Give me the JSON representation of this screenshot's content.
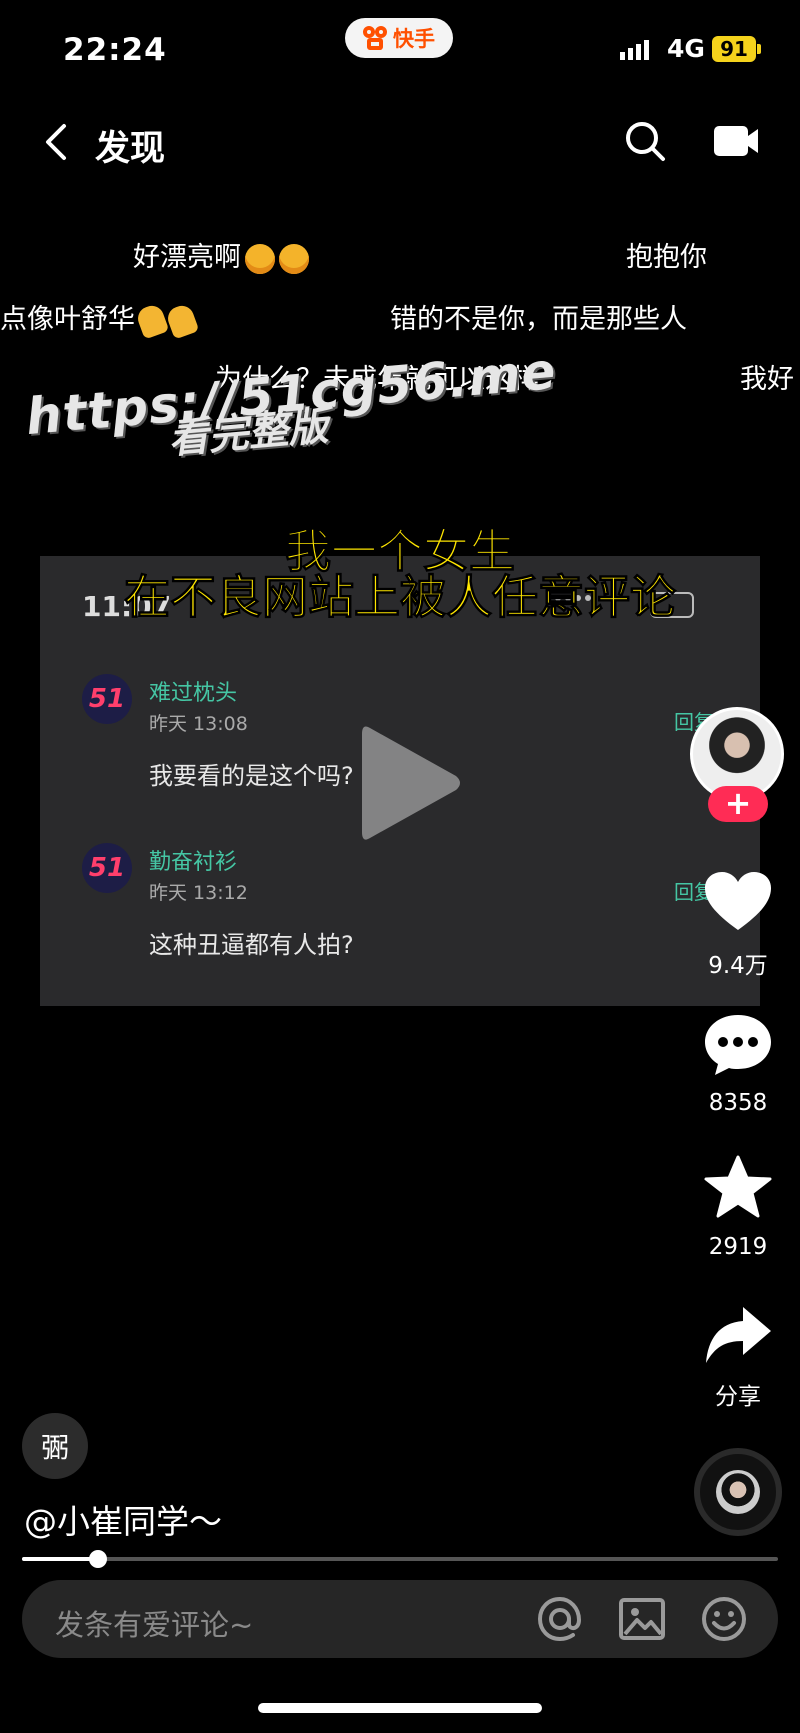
{
  "status_bar": {
    "time": "22:24",
    "app_name": "快手",
    "network": "4G",
    "battery": "91"
  },
  "nav": {
    "title": "发现",
    "icons": [
      "back-icon",
      "search-icon",
      "camera-icon"
    ]
  },
  "danmaku": [
    {
      "text": "好漂亮啊"
    },
    {
      "text": "抱抱你"
    },
    {
      "text": "点像叶舒华"
    },
    {
      "text": "错的不是你，而是那些人"
    },
    {
      "text": "为什么？未成年就可以这样"
    },
    {
      "text": "我好"
    }
  ],
  "watermark": {
    "url": "https://51cg56.me",
    "sub": "看完整版"
  },
  "video": {
    "caption_line1": "我一个女生",
    "caption_line2": "在不良网站上被人任意评论",
    "inner_time": "11:07",
    "comments": [
      {
        "avatar_text": "51",
        "name": "难过枕头",
        "time": "昨天 13:08",
        "text": "我要看的是这个吗?",
        "reply": "回复"
      },
      {
        "avatar_text": "51",
        "name": "勤奋衬衫",
        "time": "昨天 13:12",
        "text": "这种丑逼都有人拍?",
        "reply": "回复"
      }
    ]
  },
  "rail": {
    "follow_label": "+",
    "likes": "9.4万",
    "comments": "8358",
    "favorites": "2919",
    "share": "分享"
  },
  "bottom": {
    "sound_badge": "弻",
    "author": "@小崔同学～",
    "progress": 0.1,
    "comment_placeholder": "发条有爱评论~"
  },
  "colors": {
    "accent_red": "#ff2c55",
    "caption_yellow": "#ffe600",
    "kuaishou_orange": "#ff5000",
    "battery_yellow": "#f5d31c"
  }
}
